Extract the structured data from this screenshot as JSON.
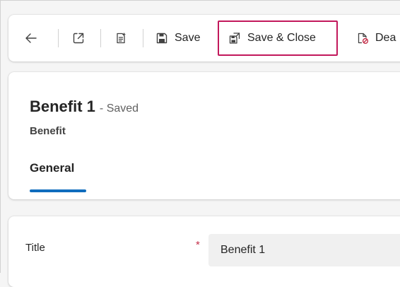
{
  "toolbar": {
    "back_icon": "arrow-left-icon",
    "open_new_window_icon": "open-in-new-window-icon",
    "form_icon": "form-flow-icon",
    "save_label": "Save",
    "save_icon": "floppy-disk-icon",
    "save_close_label": "Save & Close",
    "save_close_icon": "save-close-icon",
    "deactivate_label": "Dea",
    "deactivate_icon": "document-prohibited-icon",
    "highlight_color": "#c2185b"
  },
  "header": {
    "title": "Benefit 1",
    "status": "- Saved",
    "entity": "Benefit",
    "tabs": [
      {
        "label": "General",
        "selected": true
      }
    ],
    "tab_accent_color": "#0f6cbd"
  },
  "form": {
    "fields": [
      {
        "label": "Title",
        "required_marker": "*",
        "value": "Benefit 1"
      }
    ]
  }
}
